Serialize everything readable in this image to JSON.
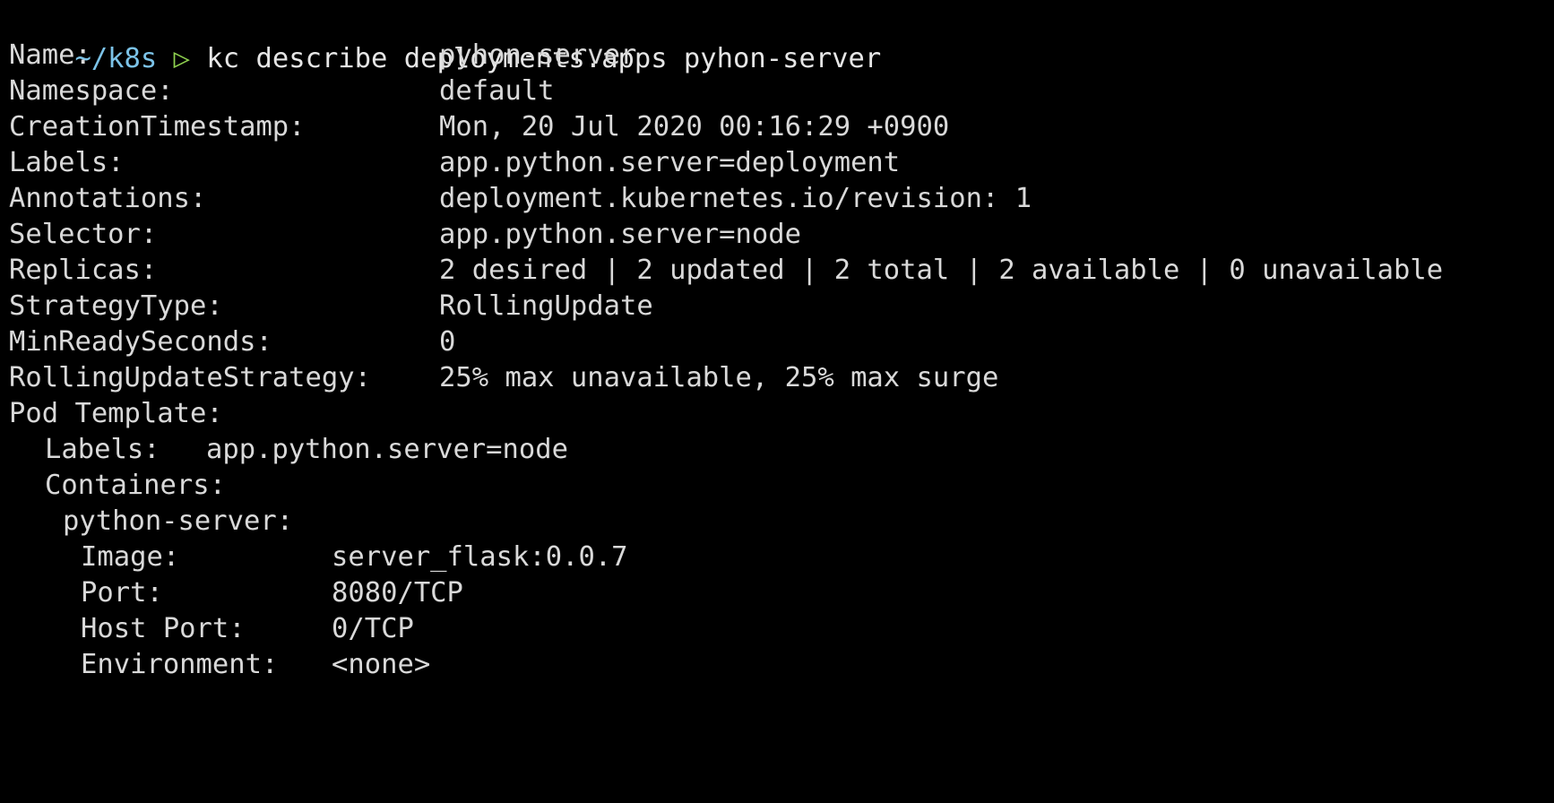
{
  "prompt": {
    "cwd": "~/k8s",
    "arrow": "▷",
    "command": "kc describe deployments.apps pyhon-server"
  },
  "top_fields": [
    {
      "label": "Name:",
      "value": "pyhon-server"
    },
    {
      "label": "Namespace:",
      "value": "default"
    },
    {
      "label": "CreationTimestamp:",
      "value": "Mon, 20 Jul 2020 00:16:29 +0900"
    },
    {
      "label": "Labels:",
      "value": "app.python.server=deployment"
    },
    {
      "label": "Annotations:",
      "value": "deployment.kubernetes.io/revision: 1"
    },
    {
      "label": "Selector:",
      "value": "app.python.server=node"
    },
    {
      "label": "Replicas:",
      "value": "2 desired | 2 updated | 2 total | 2 available | 0 unavailable"
    },
    {
      "label": "StrategyType:",
      "value": "RollingUpdate"
    },
    {
      "label": "MinReadySeconds:",
      "value": "0"
    },
    {
      "label": "RollingUpdateStrategy:",
      "value": "25% max unavailable, 25% max surge"
    }
  ],
  "pod_template": {
    "heading": "Pod Template:",
    "labels_label": "Labels:",
    "labels_value": "app.python.server=node",
    "containers_label": "Containers:",
    "container_name": "python-server:",
    "container_fields": [
      {
        "label": "Image:",
        "value": "server_flask:0.0.7"
      },
      {
        "label": "Port:",
        "value": "8080/TCP"
      },
      {
        "label": "Host Port:",
        "value": "0/TCP"
      },
      {
        "label": "Environment:",
        "value": "<none>"
      }
    ]
  },
  "colors": {
    "background": "#000000",
    "text": "#d9d9d9",
    "cwd": "#7cc3e8",
    "arrow": "#8fd14f"
  }
}
